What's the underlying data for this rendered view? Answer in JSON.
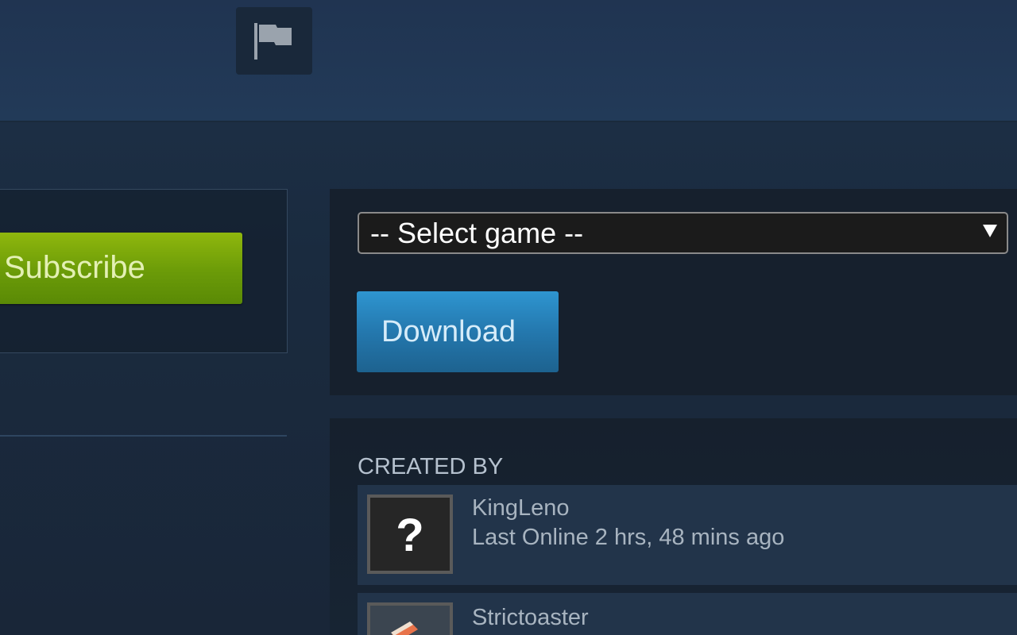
{
  "header": {
    "flag_icon": "flag-icon"
  },
  "subscribe": {
    "label": "Subscribe",
    "color": "#7aa60a"
  },
  "download_panel": {
    "select": {
      "selected": "-- Select game --"
    },
    "download_label": "Download",
    "download_color": "#2a85c0"
  },
  "created_by": {
    "heading": "CREATED BY",
    "authors": [
      {
        "name": "KingLeno",
        "status": "Last Online 2 hrs, 48 mins ago",
        "avatar_icon": "question-mark-avatar"
      },
      {
        "name": "Strictoaster",
        "avatar_icon": "user-avatar"
      }
    ]
  }
}
